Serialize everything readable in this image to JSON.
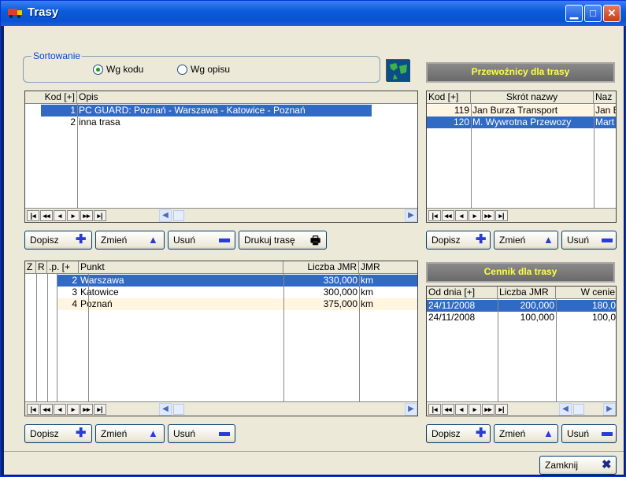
{
  "window": {
    "title": "Trasy",
    "colors": {
      "title": "#0a52d0",
      "selection": "#316ac5",
      "banner_text": "#ffff40"
    }
  },
  "sort": {
    "label": "Sortowanie",
    "by_code": "Wg kodu",
    "by_desc": "Wg opisu",
    "selected": "by_code"
  },
  "routes": {
    "headers": [
      "Kod [+]",
      "Opis"
    ],
    "rows": [
      {
        "code": "1",
        "desc": "PC GUARD: Poznań - Warszawa - Katowice - Poznań",
        "selected": true
      },
      {
        "code": "2",
        "desc": "inna trasa",
        "selected": false
      }
    ]
  },
  "route_buttons": {
    "add": "Dopisz",
    "edit": "Zmień",
    "delete": "Usuń",
    "print": "Drukuj trasę"
  },
  "carriers": {
    "banner": "Przewoźnicy dla trasy",
    "headers": [
      "Kod [+]",
      "Skrót nazwy",
      "Naz"
    ],
    "rows": [
      {
        "code": "119",
        "short": "Jan Burza Transport",
        "name": "Jan B"
      },
      {
        "code": "120",
        "short": "M. Wywrotna Przewozy",
        "name": "Mart"
      }
    ]
  },
  "carrier_buttons": {
    "add": "Dopisz",
    "edit": "Zmień",
    "delete": "Usuń"
  },
  "points": {
    "headers": [
      "Z",
      "R",
      ".p. [+",
      "Punkt",
      "Liczba JMR",
      "JMR"
    ],
    "rows": [
      {
        "lp": "2",
        "point": "Warszawa",
        "qty": "330,000",
        "unit": "km"
      },
      {
        "lp": "3",
        "point": "Katowice",
        "qty": "300,000",
        "unit": "km"
      },
      {
        "lp": "4",
        "point": "Poznań",
        "qty": "375,000",
        "unit": "km"
      }
    ]
  },
  "point_buttons": {
    "add": "Dopisz",
    "edit": "Zmień",
    "delete": "Usuń"
  },
  "pricing": {
    "banner": "Cennik dla trasy",
    "headers": [
      "Od dnia [+]",
      "Liczba JMR",
      "W cenie"
    ],
    "rows": [
      {
        "date": "24/11/2008",
        "qty": "200,000",
        "price": "180,0"
      },
      {
        "date": "24/11/2008",
        "qty": "100,000",
        "price": "100,0"
      }
    ]
  },
  "pricing_buttons": {
    "add": "Dopisz",
    "edit": "Zmień",
    "delete": "Usuń"
  },
  "close_button": "Zamknij"
}
